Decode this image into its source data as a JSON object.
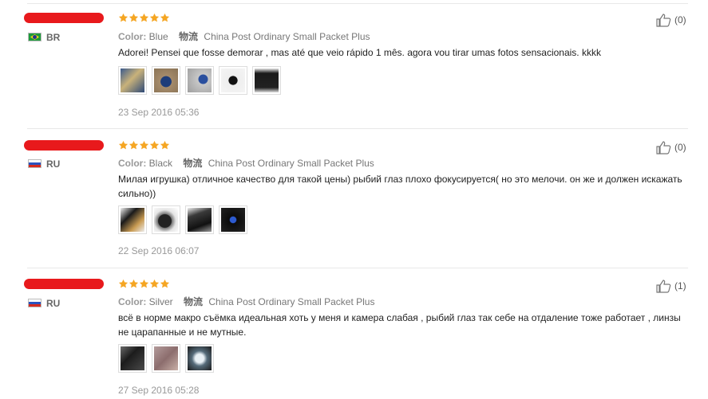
{
  "reviews": [
    {
      "country": "BR",
      "flag": "brazil-flag",
      "rating": 5,
      "color_label": "Color:",
      "color_value": "Blue",
      "shipping_label": "物流",
      "shipping_value": "China Post Ordinary Small Packet Plus",
      "text": "Adorei! Pensei que fosse demorar , mas até que veio rápido 1 mês. agora vou tirar umas fotos sensacionais. kkkk",
      "photos": 5,
      "date": "23 Sep 2016 05:36",
      "likes": "(0)"
    },
    {
      "country": "RU",
      "flag": "russia-flag",
      "rating": 5,
      "color_label": "Color:",
      "color_value": "Black",
      "shipping_label": "物流",
      "shipping_value": "China Post Ordinary Small Packet Plus",
      "text": "Милая игрушка) отличное качество для такой цены) рыбий глаз плохо фокусируется( но это мелочи. он же и должен искажать сильно))",
      "photos": 4,
      "date": "22 Sep 2016 06:07",
      "likes": "(0)"
    },
    {
      "country": "RU",
      "flag": "russia-flag",
      "rating": 5,
      "color_label": "Color:",
      "color_value": "Silver",
      "shipping_label": "物流",
      "shipping_value": "China Post Ordinary Small Packet Plus",
      "text": "всё в норме макро съёмка идеальная хоть у меня и камера слабая , рыбий глаз так себе на отдаление тоже работает , линзы не царапанные и не мутные.",
      "photos": 3,
      "date": "27 Sep 2016 05:28",
      "likes": "(1)"
    }
  ],
  "colors": {
    "star": "#f5a623",
    "redaction": "#e8191c",
    "date": "#999999"
  }
}
